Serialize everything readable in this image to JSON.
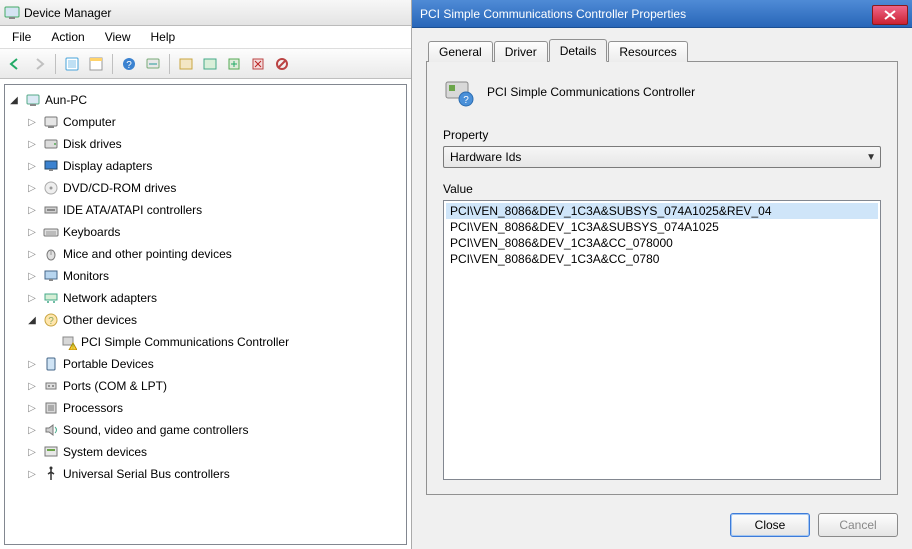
{
  "devmgr": {
    "window_title": "Device Manager",
    "menus": [
      "File",
      "Action",
      "View",
      "Help"
    ],
    "toolbar_icons": [
      "back-arrow-icon",
      "forward-arrow-icon",
      "sep",
      "show-hidden-icon",
      "properties-pane-icon",
      "sep",
      "help-icon",
      "scan-hardware-icon",
      "sep",
      "view-tree-icon",
      "view-by-type-icon",
      "update-driver-icon",
      "uninstall-icon",
      "disable-icon"
    ],
    "root": "Aun-PC",
    "nodes": [
      {
        "label": "Computer",
        "icon": "computer-icon",
        "expanded": false
      },
      {
        "label": "Disk drives",
        "icon": "disk-icon",
        "expanded": false
      },
      {
        "label": "Display adapters",
        "icon": "display-icon",
        "expanded": false
      },
      {
        "label": "DVD/CD-ROM drives",
        "icon": "dvd-icon",
        "expanded": false
      },
      {
        "label": "IDE ATA/ATAPI controllers",
        "icon": "ide-icon",
        "expanded": false
      },
      {
        "label": "Keyboards",
        "icon": "keyboard-icon",
        "expanded": false
      },
      {
        "label": "Mice and other pointing devices",
        "icon": "mouse-icon",
        "expanded": false
      },
      {
        "label": "Monitors",
        "icon": "monitor-icon",
        "expanded": false
      },
      {
        "label": "Network adapters",
        "icon": "network-icon",
        "expanded": false
      },
      {
        "label": "Other devices",
        "icon": "other-icon",
        "expanded": true,
        "children": [
          {
            "label": "PCI Simple Communications Controller",
            "icon": "warning-device-icon"
          }
        ]
      },
      {
        "label": "Portable Devices",
        "icon": "portable-icon",
        "expanded": false
      },
      {
        "label": "Ports (COM & LPT)",
        "icon": "ports-icon",
        "expanded": false
      },
      {
        "label": "Processors",
        "icon": "cpu-icon",
        "expanded": false
      },
      {
        "label": "Sound, video and game controllers",
        "icon": "sound-icon",
        "expanded": false
      },
      {
        "label": "System devices",
        "icon": "system-icon",
        "expanded": false
      },
      {
        "label": "Universal Serial Bus controllers",
        "icon": "usb-icon",
        "expanded": false
      }
    ]
  },
  "props": {
    "window_title": "PCI Simple Communications Controller Properties",
    "tabs": [
      "General",
      "Driver",
      "Details",
      "Resources"
    ],
    "active_tab": "Details",
    "device_name": "PCI Simple Communications Controller",
    "property_label": "Property",
    "property_value": "Hardware Ids",
    "value_label": "Value",
    "values": [
      "PCI\\VEN_8086&DEV_1C3A&SUBSYS_074A1025&REV_04",
      "PCI\\VEN_8086&DEV_1C3A&SUBSYS_074A1025",
      "PCI\\VEN_8086&DEV_1C3A&CC_078000",
      "PCI\\VEN_8086&DEV_1C3A&CC_0780"
    ],
    "selected_value_index": 0,
    "buttons": {
      "close": "Close",
      "cancel": "Cancel"
    }
  }
}
